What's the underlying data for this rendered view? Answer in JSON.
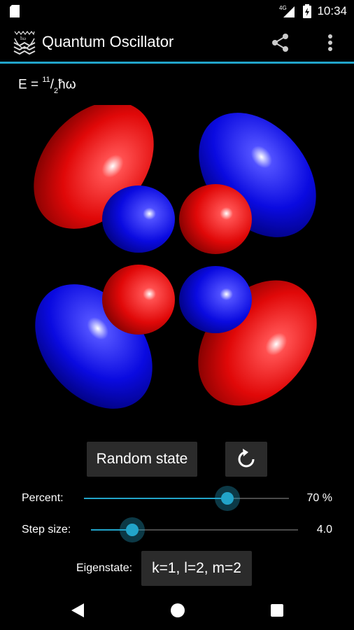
{
  "status_bar": {
    "time": "10:34",
    "network": "4G",
    "icons": [
      "sd-card-icon",
      "signal-icon",
      "battery-icon"
    ]
  },
  "app_bar": {
    "title": "Quantum Oscillator",
    "logo_icon": "harmonic-oscillator-logo-icon",
    "actions": [
      "share-icon",
      "more-vert-icon"
    ],
    "accent_color": "#22a4c9"
  },
  "energy": {
    "prefix": "E = ",
    "numerator": "11",
    "slash": "/",
    "denominator": "2",
    "suffix": "ħω"
  },
  "orbital": {
    "positive_color": "#e01010",
    "negative_color": "#1010e0"
  },
  "controls": {
    "random_state_label": "Random state",
    "reset_icon": "refresh-icon",
    "percent": {
      "label": "Percent:",
      "value": 0.7,
      "value_text": "70 %"
    },
    "step_size": {
      "label": "Step size:",
      "value": 0.2,
      "value_text": "4.0"
    },
    "eigenstate": {
      "label": "Eigenstate:",
      "button_label": "k=1, l=2, m=2"
    }
  },
  "nav_bar": {
    "icons": [
      "back-icon",
      "home-icon",
      "recents-icon"
    ]
  }
}
